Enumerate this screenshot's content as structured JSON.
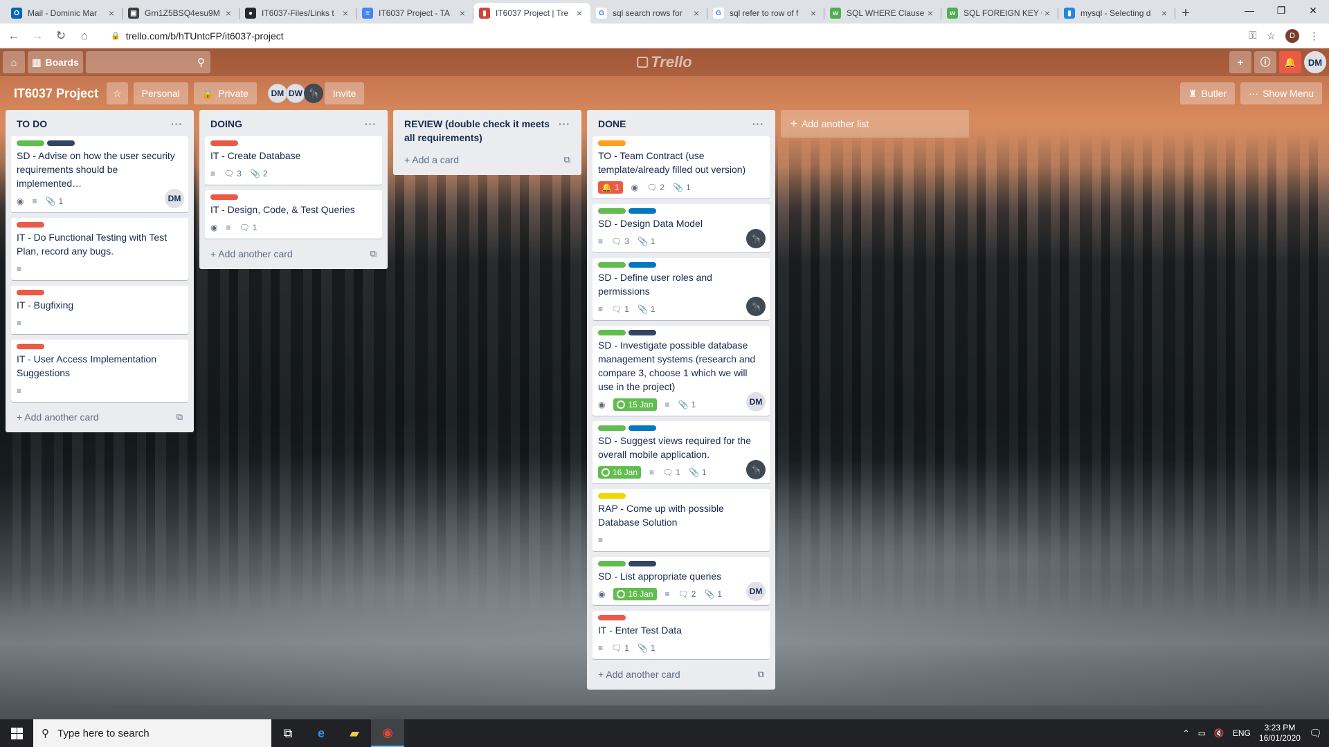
{
  "browser": {
    "tabs": [
      {
        "title": "Mail - Dominic Mar",
        "icon": "outlook-icon",
        "color": "#0364b8",
        "glyph": "O"
      },
      {
        "title": "Grn1Z5BSQ4esu9M",
        "icon": "page-icon",
        "color": "#3c4043",
        "glyph": "▣"
      },
      {
        "title": "IT6037-Files/Links t",
        "icon": "github-icon",
        "color": "#24292e",
        "glyph": "●"
      },
      {
        "title": "IT6037 Project - TA",
        "icon": "docs-icon",
        "color": "#4285f4",
        "glyph": "≡"
      },
      {
        "title": "IT6037 Project | Tre",
        "icon": "trello-icon",
        "color": "#d04437",
        "glyph": "▮"
      },
      {
        "title": "sql search rows for",
        "icon": "google-icon",
        "color": "#ffffff",
        "glyph": "G"
      },
      {
        "title": "sql refer to row of f",
        "icon": "google-icon",
        "color": "#ffffff",
        "glyph": "G"
      },
      {
        "title": "SQL WHERE Clause",
        "icon": "w3schools-icon",
        "color": "#4caf50",
        "glyph": "w"
      },
      {
        "title": "SQL FOREIGN KEY C",
        "icon": "w3schools-icon",
        "color": "#4caf50",
        "glyph": "w"
      },
      {
        "title": "mysql - Selecting d",
        "icon": "stackoverflow-icon",
        "color": "#1e88e5",
        "glyph": "▮"
      }
    ],
    "active_tab": 4,
    "url": "trello.com/b/hTUntcFP/it6037-project",
    "profile_initial": "D"
  },
  "header": {
    "boards_label": "Boards",
    "logo_text": "Trello",
    "user_initials": "DM"
  },
  "board": {
    "title": "IT6037 Project",
    "team_label": "Personal",
    "visibility_label": "Private",
    "members": [
      "DM",
      "DW",
      "🦍"
    ],
    "invite_label": "Invite",
    "butler_label": "Butler",
    "menu_label": "Show Menu",
    "add_list_label": "Add another list"
  },
  "colors": {
    "green": "#61bd4f",
    "navy": "#344563",
    "blue": "#0079bf",
    "red": "#eb5a46",
    "orange": "#ff9f1a",
    "yellow": "#f2d600"
  },
  "lists": [
    {
      "title": "TO DO",
      "add_label": "Add another card",
      "cards": [
        {
          "labels": [
            "green",
            "navy"
          ],
          "title": "SD - Advise on how the user security requirements should be implemented…",
          "watch": true,
          "desc": true,
          "attachments": "1",
          "member": "DM"
        },
        {
          "labels": [
            "red"
          ],
          "title": "IT - Do Functional Testing with Test Plan, record any bugs.",
          "desc": true
        },
        {
          "labels": [
            "red"
          ],
          "title": "IT - Bugfixing",
          "desc": true
        },
        {
          "labels": [
            "red"
          ],
          "title": "IT - User Access Implementation Suggestions",
          "desc": true
        }
      ]
    },
    {
      "title": "DOING",
      "add_label": "Add another card",
      "cards": [
        {
          "labels": [
            "red"
          ],
          "title": "IT - Create Database",
          "desc": true,
          "comments": "3",
          "attachments": "2"
        },
        {
          "labels": [
            "red"
          ],
          "title": "IT - Design, Code, & Test Queries",
          "watch": true,
          "desc": true,
          "comments": "1"
        }
      ]
    },
    {
      "title": "REVIEW (double check it meets all requirements)",
      "add_label": "Add a card",
      "cards": []
    },
    {
      "title": "DONE",
      "add_label": "Add another card",
      "cards": [
        {
          "labels": [
            "orange"
          ],
          "title": "TO - Team Contract (use template/already filled out version)",
          "notification": "1",
          "watch": true,
          "comments": "2",
          "attachments": "1"
        },
        {
          "labels": [
            "green",
            "blue"
          ],
          "title": "SD - Design Data Model",
          "desc": true,
          "comments": "3",
          "attachments": "1",
          "member": "🦍"
        },
        {
          "labels": [
            "green",
            "blue"
          ],
          "title": "SD - Define user roles and permissions",
          "desc": true,
          "comments": "1",
          "attachments": "1",
          "member": "🦍"
        },
        {
          "labels": [
            "green",
            "navy"
          ],
          "title": "SD - Investigate possible database management systems (research and compare 3, choose 1 which we will use in the project)",
          "watch": true,
          "due": "15 Jan",
          "desc": true,
          "attachments": "1",
          "member": "DM"
        },
        {
          "labels": [
            "green",
            "blue"
          ],
          "title": "SD - Suggest views required for the overall mobile application.",
          "due": "16 Jan",
          "desc": true,
          "comments": "1",
          "attachments": "1",
          "member": "🦍"
        },
        {
          "labels": [
            "yellow"
          ],
          "title": "RAP - Come up with possible Database Solution",
          "desc": true
        },
        {
          "labels": [
            "green",
            "navy"
          ],
          "title": "SD - List appropriate queries",
          "watch": true,
          "due": "16 Jan",
          "desc": true,
          "comments": "2",
          "attachments": "1",
          "member": "DM"
        },
        {
          "labels": [
            "red"
          ],
          "title": "IT - Enter Test Data",
          "desc": true,
          "comments": "1",
          "attachments": "1"
        }
      ]
    }
  ],
  "taskbar": {
    "search_placeholder": "Type here to search",
    "language": "ENG",
    "time": "3:23 PM",
    "date": "16/01/2020"
  }
}
